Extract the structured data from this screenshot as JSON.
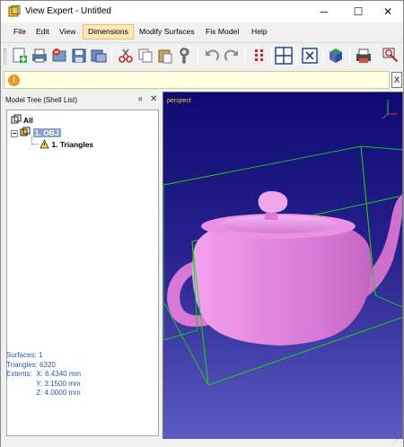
{
  "window": {
    "title": "View Expert - Untitled",
    "minimize_glyph": "─",
    "maximize_glyph": "☐",
    "close_glyph": "✕"
  },
  "menu": {
    "items": [
      "File",
      "Edit",
      "View",
      "Dimensions",
      "Modify Surfaces",
      "Fix Model",
      "Help"
    ],
    "active": "Dimensions"
  },
  "toolbar": {
    "icons": [
      "new-icon",
      "print-icon",
      "open-icon",
      "save-icon",
      "print-preview-icon",
      "cut-icon",
      "copy-icon",
      "paste-icon",
      "repair-icon",
      "undo-icon",
      "redo-icon",
      "grid-icon",
      "select-icon",
      "close-model-icon",
      "render-icon",
      "printer-icon",
      "search-icon"
    ]
  },
  "infobar": {
    "icon_glyph": "i",
    "close_glyph": "X"
  },
  "model_tree": {
    "title": "Model Tree (Shell List)",
    "pin_glyph": "¤",
    "close_glyph": "✕",
    "root_label": "All",
    "object_label": "1. OBJ",
    "expander_glyph": "−",
    "child_label": "1. Triangles"
  },
  "stats": {
    "surfaces": "Surfaces: 1",
    "triangles": "Triangles: 6320",
    "extents_x": "Extents:  X: 6.4340 mm",
    "extents_y": "               Y: 3.1500 mm",
    "extents_z": "               Z: 4.0000 mm"
  },
  "viewport": {
    "label": "perspect",
    "background_top": "#0f0a72",
    "background_bottom": "#5c5dc2",
    "model_color": "#e58be0",
    "bbox_color": "#19d219"
  },
  "colors": {
    "menu_active_bg": "#fde6b8",
    "infobar_bg": "#ffffe1",
    "stats_text": "#2a5aa8",
    "selected_tree_bg": "#8aa2c8"
  }
}
